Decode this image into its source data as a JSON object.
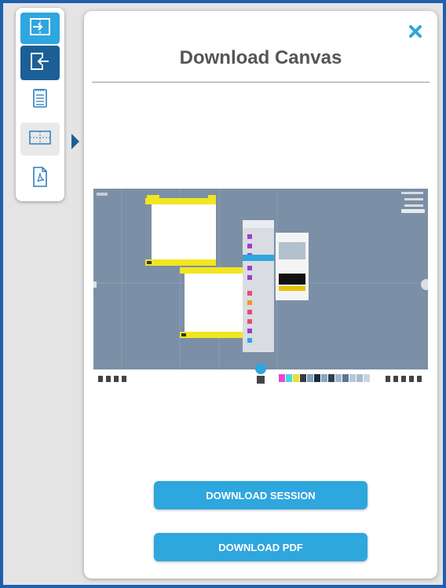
{
  "toolbar": {
    "items": [
      {
        "icon": "import-icon",
        "active": false
      },
      {
        "icon": "export-icon",
        "active": true
      },
      {
        "icon": "notepad-icon",
        "active": false
      },
      {
        "icon": "canvas-layout-icon",
        "active": false
      },
      {
        "icon": "pdf-file-icon",
        "active": false
      }
    ]
  },
  "panel": {
    "title": "Download Canvas",
    "close_icon": "close-icon",
    "buttons": {
      "download_session": "DOWNLOAD SESSION",
      "download_pdf": "DOWNLOAD PDF"
    }
  },
  "colors": {
    "accent": "#2ea6de",
    "accent_dark": "#1c5f97",
    "title": "#555555",
    "preview_bg": "#7b8fa6",
    "sticky_yellow": "#f2e521"
  }
}
